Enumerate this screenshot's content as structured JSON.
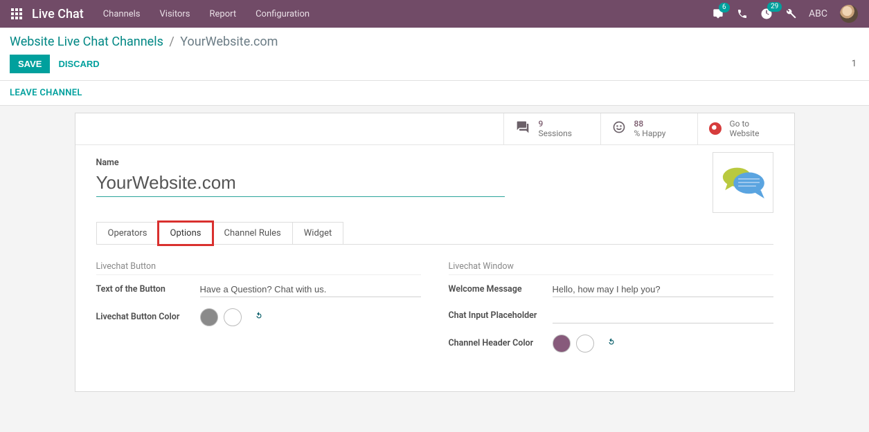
{
  "topbar": {
    "brand": "Live Chat",
    "nav": [
      "Channels",
      "Visitors",
      "Report",
      "Configuration"
    ],
    "messages_badge": "6",
    "activities_badge": "29",
    "user": "ABC"
  },
  "breadcrumb": {
    "root": "Website Live Chat Channels",
    "current": "YourWebsite.com"
  },
  "actions": {
    "save": "SAVE",
    "discard": "DISCARD",
    "counter": "1",
    "leave": "LEAVE CHANNEL"
  },
  "stats": {
    "sessions": {
      "value": "9",
      "label": "Sessions"
    },
    "happy": {
      "value": "88",
      "label": "% Happy"
    },
    "website": {
      "line1": "Go to",
      "line2": "Website"
    }
  },
  "form": {
    "name_label": "Name",
    "name_value": "YourWebsite.com"
  },
  "tabs": [
    "Operators",
    "Options",
    "Channel Rules",
    "Widget"
  ],
  "options": {
    "left": {
      "section": "Livechat Button",
      "text_label": "Text of the Button",
      "text_value": "Have a Question? Chat with us.",
      "color_label": "Livechat Button Color",
      "swatches": [
        "#8a8a8a",
        "#ffffff"
      ]
    },
    "right": {
      "section": "Livechat Window",
      "welcome_label": "Welcome Message",
      "welcome_value": "Hello, how may I help you?",
      "placeholder_label": "Chat Input Placeholder",
      "placeholder_value": "",
      "header_color_label": "Channel Header Color",
      "swatches": [
        "#875A7B",
        "#ffffff"
      ]
    }
  }
}
